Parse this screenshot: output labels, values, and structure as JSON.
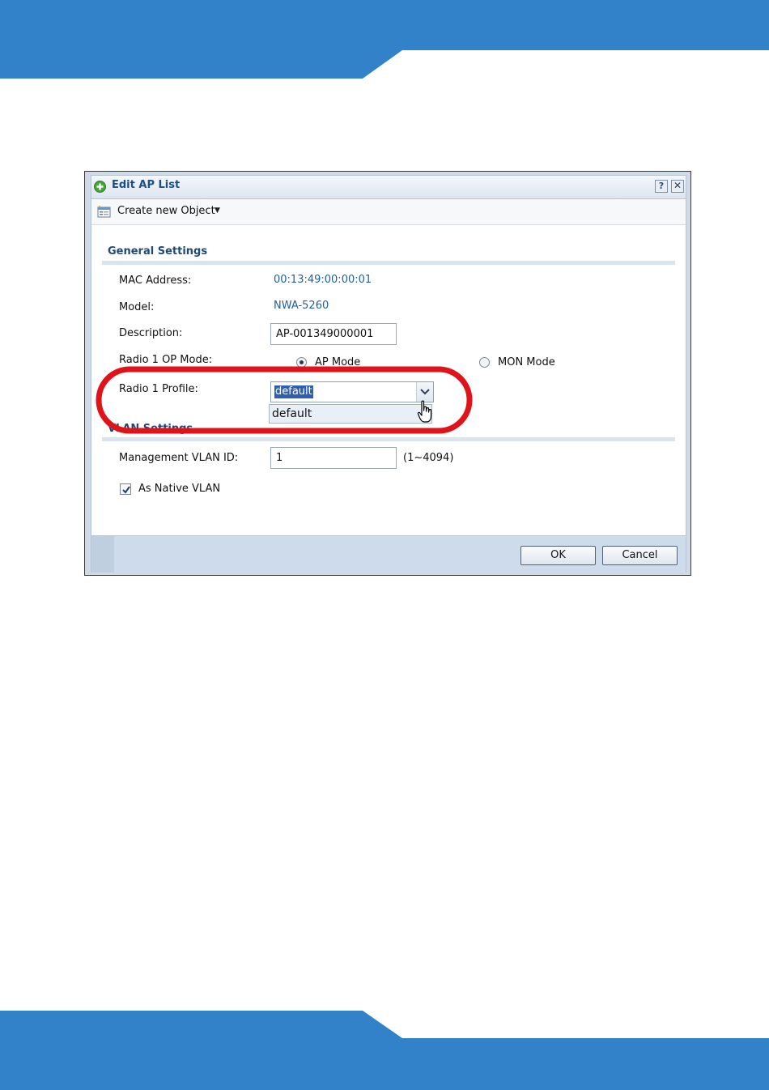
{
  "dialog": {
    "title": "Edit AP List",
    "help_glyph": "?",
    "close_glyph": "✕",
    "icon": "add-circle-icon"
  },
  "toolbar": {
    "create_label": "Create new Object",
    "create_caret": "▼",
    "icon": "new-object-icon"
  },
  "general": {
    "section_title": "General Settings",
    "mac_label": "MAC Address:",
    "mac_value": "00:13:49:00:00:01",
    "model_label": "Model:",
    "model_value": "NWA-5260",
    "description_label": "Description:",
    "description_value": "AP-001349000001",
    "op_mode_label": "Radio 1 OP Mode:",
    "op_mode_options": [
      "AP Mode",
      "MON Mode"
    ],
    "op_mode_selected": "AP Mode",
    "profile_label": "Radio 1 Profile:",
    "profile_value": "default",
    "profile_options": [
      "default"
    ]
  },
  "vlan": {
    "section_title": "VLAN Settings",
    "mgmt_label": "Management VLAN ID:",
    "mgmt_value": "1",
    "mgmt_range": "(1~4094)",
    "native_label": "As Native VLAN",
    "native_checked": true
  },
  "footer": {
    "ok_label": "OK",
    "cancel_label": "Cancel"
  },
  "colors": {
    "brand_blue": "#3282c9",
    "highlight_red": "#e0131a",
    "link_blue": "#1f5fa0",
    "selection_blue": "#2f5fb3"
  }
}
